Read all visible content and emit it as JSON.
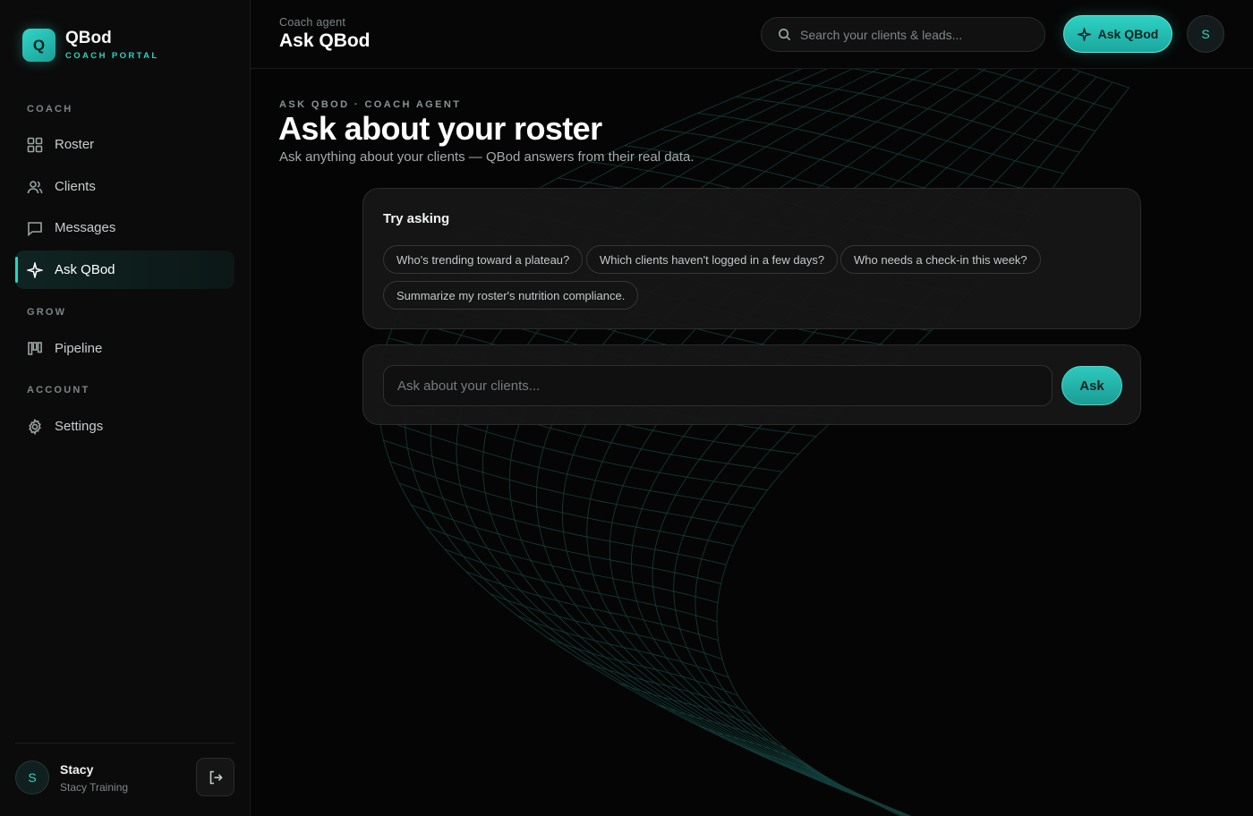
{
  "brand": {
    "logo_letter": "Q",
    "name": "QBod",
    "subtitle": "COACH PORTAL"
  },
  "sidebar": {
    "sections": [
      {
        "label": "COACH"
      },
      {
        "label": "GROW"
      },
      {
        "label": "ACCOUNT"
      }
    ],
    "items": [
      {
        "label": "Roster",
        "icon": "grid-icon",
        "active": false
      },
      {
        "label": "Clients",
        "icon": "users-icon",
        "active": false
      },
      {
        "label": "Messages",
        "icon": "message-icon",
        "active": false
      },
      {
        "label": "Ask QBod",
        "icon": "sparkle-icon",
        "active": true
      },
      {
        "label": "Pipeline",
        "icon": "kanban-icon",
        "active": false
      },
      {
        "label": "Settings",
        "icon": "gear-icon",
        "active": false
      }
    ],
    "user": {
      "initial": "S",
      "name": "Stacy",
      "org": "Stacy Training",
      "logout_icon": "logout-icon"
    }
  },
  "header": {
    "subtitle": "Coach agent",
    "title": "Ask QBod",
    "search_placeholder": "Search your clients & leads...",
    "ask_button": "Ask QBod",
    "avatar_initial": "S"
  },
  "main": {
    "eyebrow": "ASK QBOD · COACH AGENT",
    "title": "Ask about your roster",
    "description": "Ask anything about your clients — QBod answers from their real data.",
    "suggestions_title": "Try asking",
    "suggestions": [
      "Who's trending toward a plateau?",
      "Which clients haven't logged in a few days?",
      "Who needs a check-in this week?",
      "Summarize my roster's nutrition compliance."
    ],
    "ask_placeholder": "Ask about your clients...",
    "ask_button": "Ask"
  },
  "colors": {
    "accent": "#2dd4bf",
    "background": "#050505",
    "sidebar": "#0b0b0b",
    "card": "#161616"
  }
}
